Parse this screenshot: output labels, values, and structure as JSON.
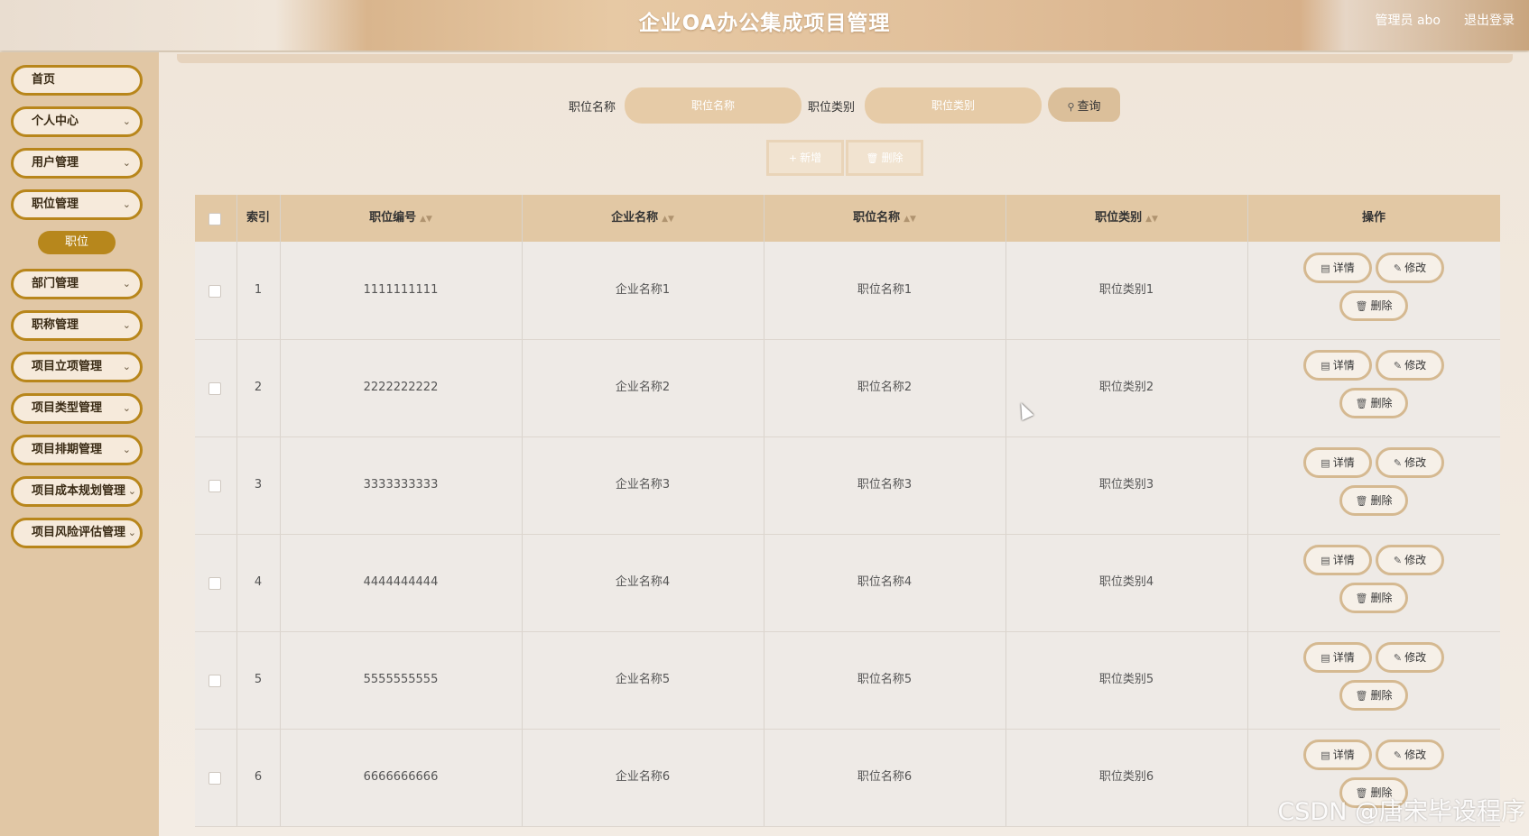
{
  "header": {
    "title": "企业OA办公集成项目管理",
    "user": "管理员 abo",
    "logout": "退出登录"
  },
  "sidebar": {
    "items": [
      {
        "label": "首页",
        "has_chevron": false
      },
      {
        "label": "个人中心",
        "has_chevron": true
      },
      {
        "label": "用户管理",
        "has_chevron": true
      },
      {
        "label": "职位管理",
        "has_chevron": true
      },
      {
        "label": "部门管理",
        "has_chevron": true
      },
      {
        "label": "职称管理",
        "has_chevron": true
      },
      {
        "label": "项目立项管理",
        "has_chevron": true
      },
      {
        "label": "项目类型管理",
        "has_chevron": true
      },
      {
        "label": "项目排期管理",
        "has_chevron": true
      },
      {
        "label": "项目成本规划管理",
        "has_chevron": true
      },
      {
        "label": "项目风险评估管理",
        "has_chevron": true
      }
    ],
    "active_sub": "职位"
  },
  "search": {
    "name_label": "职位名称",
    "name_placeholder": "职位名称",
    "type_label": "职位类别",
    "type_placeholder": "职位类别",
    "query_button": "查询"
  },
  "actions": {
    "add": "新增",
    "delete": "删除"
  },
  "table": {
    "columns": [
      "索引",
      "职位编号",
      "企业名称",
      "职位名称",
      "职位类别",
      "操作"
    ],
    "rows": [
      {
        "index": "1",
        "code": "1111111111",
        "company": "企业名称1",
        "name": "职位名称1",
        "type": "职位类别1"
      },
      {
        "index": "2",
        "code": "2222222222",
        "company": "企业名称2",
        "name": "职位名称2",
        "type": "职位类别2"
      },
      {
        "index": "3",
        "code": "3333333333",
        "company": "企业名称3",
        "name": "职位名称3",
        "type": "职位类别3"
      },
      {
        "index": "4",
        "code": "4444444444",
        "company": "企业名称4",
        "name": "职位名称4",
        "type": "职位类别4"
      },
      {
        "index": "5",
        "code": "5555555555",
        "company": "企业名称5",
        "name": "职位名称5",
        "type": "职位类别5"
      },
      {
        "index": "6",
        "code": "6666666666",
        "company": "企业名称6",
        "name": "职位名称6",
        "type": "职位类别6"
      }
    ],
    "op_labels": {
      "detail": "详情",
      "edit": "修改",
      "delete": "删除"
    }
  },
  "watermark": "CSDN @唐宋毕设程序"
}
